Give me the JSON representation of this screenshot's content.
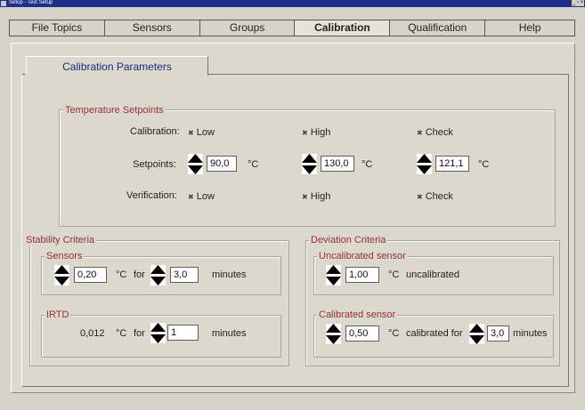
{
  "window": {
    "title": "Setup - Test Setup"
  },
  "tabs": [
    "File Topics",
    "Sensors",
    "Groups",
    "Calibration",
    "Qualification",
    "Help"
  ],
  "active_tab": "Calibration",
  "subtab": "Calibration Parameters",
  "temperature": {
    "title": "Temperature Setpoints",
    "calibration_label": "Calibration:",
    "setpoints_label": "Setpoints:",
    "verification_label": "Verification:",
    "options": [
      "Low",
      "High",
      "Check"
    ],
    "setpoints": [
      "90,0",
      "130,0",
      "121,1"
    ],
    "unit": "°C"
  },
  "stability": {
    "title": "Stability Criteria",
    "sensors": {
      "title": "Sensors",
      "value": "0,20",
      "unit": "°C",
      "for": "for",
      "minutes_value": "3,0",
      "minutes": "minutes"
    },
    "irtd": {
      "title": "IRTD",
      "value": "0,012",
      "unit": "°C",
      "for": "for",
      "minutes_value": "1",
      "minutes": "minutes"
    }
  },
  "deviation": {
    "title": "Deviation Criteria",
    "uncalibrated": {
      "title": "Uncalibrated sensor",
      "value": "1,00",
      "unit": "°C",
      "text": "uncalibrated"
    },
    "calibrated": {
      "title": "Calibrated sensor",
      "value": "0,50",
      "unit": "°C",
      "text": "calibrated for",
      "minutes_value": "3,0",
      "minutes": "minutes"
    }
  },
  "icons": {
    "spinner": "up-down-arrows-icon",
    "radio_mark": "x-mark-icon"
  }
}
